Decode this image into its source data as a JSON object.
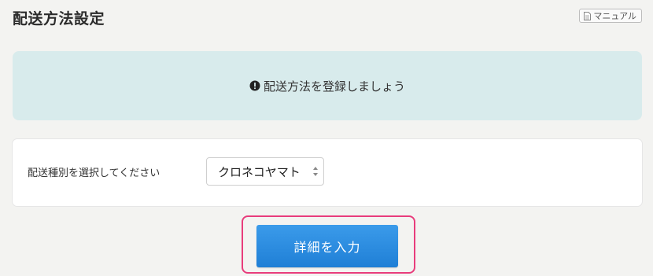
{
  "header": {
    "title": "配送方法設定",
    "manual_label": "マニュアル",
    "manual_icon": "document-icon"
  },
  "notice": {
    "icon": "exclamation-circle-icon",
    "message": "配送方法を登録しましょう",
    "background": "#d8ebec"
  },
  "form": {
    "shipping_type_label": "配送種別を選択してください",
    "shipping_type_selected": "クロネコヤマト"
  },
  "actions": {
    "submit_label": "詳細を入力",
    "submit_color": "#2b8ce0",
    "highlight_color": "#e83c7c"
  }
}
